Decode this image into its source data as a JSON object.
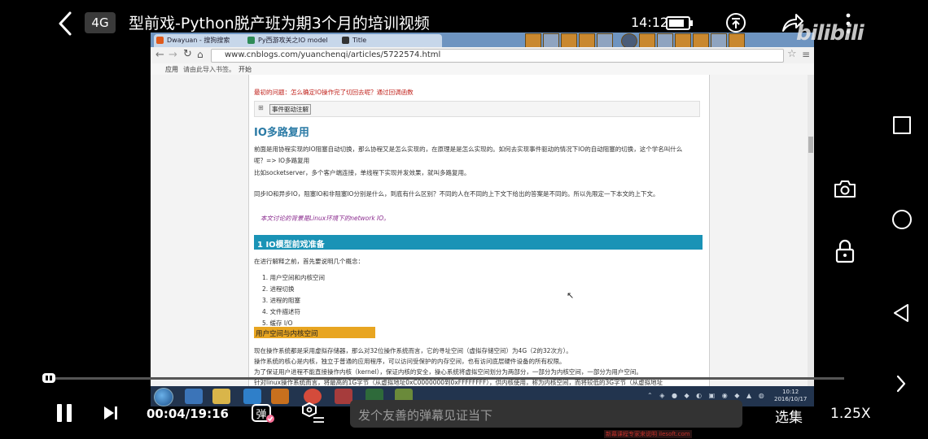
{
  "status_bar": {
    "network": "4G",
    "time": "14:12"
  },
  "header": {
    "title": "型前戏-Python脱产班为期3个月的培训视频",
    "logo": "bilibili"
  },
  "browser": {
    "tabs": [
      {
        "label": "Dwayuan - 搜狗搜索"
      },
      {
        "label": "Py西游攻关之IO model"
      },
      {
        "label": "Title"
      }
    ],
    "url": "www.cnblogs.com/yuanchenqi/articles/5722574.html",
    "bookmarks": {
      "apps": "应用",
      "hint": "请由此导入书签。",
      "start": "开始"
    }
  },
  "article": {
    "question": "最初的问题：怎么确定IO操作完了切回去呢？通过回调函数",
    "event_button": "事件驱动注解",
    "heading": "IO多路复用",
    "p1": "前面是用协程实现的IO阻塞自动切换，那么协程又是怎么实现的，在原理是是怎么实现的。如何去实现事件驱动的情况下IO的自动阻塞的切换，这个学名叫什么",
    "p2": "呢？=> IO多路复用",
    "p3": "比如socketserver，多个客户端连接，单线程下实现并发效果，就叫多路复用。",
    "p4": "同步IO和异步IO，阻塞IO和非阻塞IO分别是什么，到底有什么区别？不同的人在不同的上下文下给出的答案是不同的。所以先限定一下本文的上下文。",
    "note": "本文讨论的背景是Linux环境下的network IO。",
    "section_title": "1 IO模型前戏准备",
    "intro": "在进行解释之前，首先要说明几个概念：",
    "list": [
      "1. 用户空间和内核空间",
      "2. 进程切换",
      "3. 进程的阻塞",
      "4. 文件描述符",
      "5. 缓存 I/O"
    ],
    "subheading": "用户空间与内核空间",
    "body": [
      "现在操作系统都是采用虚拟存储器，那么对32位操作系统而言，它的寻址空间（虚拟存储空间）为4G（2的32次方）。",
      "操作系统的核心是内核，独立于普通的应用程序，可以访问受保护的内存空间，也有访问底层硬件设备的所有权限。",
      "为了保证用户进程不能直接操作内核（kernel），保证内核的安全，操心系统将虚拟空间划分为两部分，一部分为内核空间，一部分为用户空间。",
      "针对linux操作系统而言，将最高的1G字节（从虚拟地址0xC0000000到0xFFFFFFFF），供内核使用，称为内核空间，而将较低的3G字节（从虚拟地址"
    ]
  },
  "taskbar": {
    "time": "10:12",
    "date": "2016/10/17"
  },
  "player": {
    "time_display": "00:04/19:16",
    "progress": 0.0035,
    "danmaku_toggle_label": "弹",
    "danmaku_placeholder": "发个友善的弹幕见证当下",
    "episodes_label": "选集",
    "speed_label": "1.25X"
  },
  "watermark": "新幕课程专家来说明 ilesoft.com",
  "colors": {
    "progress_fill": "#fb7299",
    "section_bar": "#1a93b6",
    "subheading_highlight": "#e8a521",
    "question_red": "#c0201a",
    "heading_blue": "#2a7aa5"
  }
}
